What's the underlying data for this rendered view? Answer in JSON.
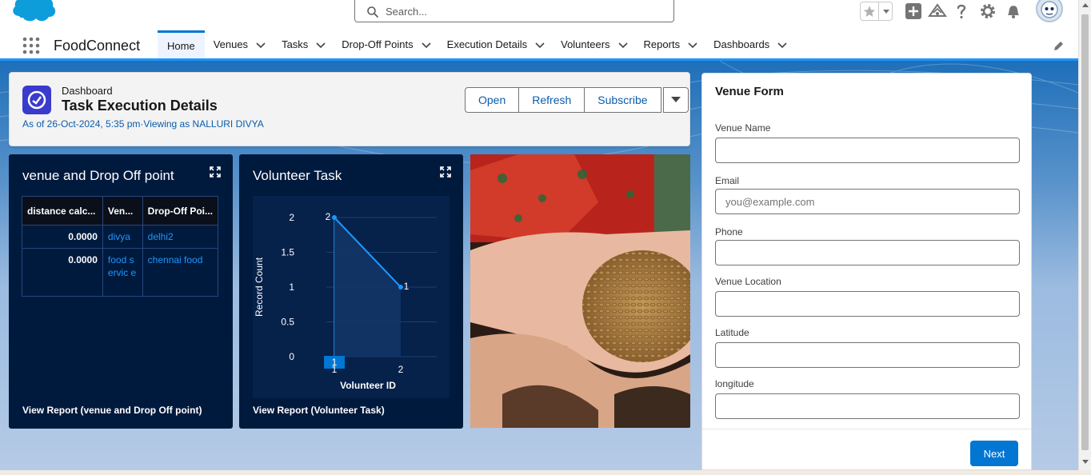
{
  "header": {
    "search_placeholder": "Search..."
  },
  "nav": {
    "app_name": "FoodConnect",
    "items": [
      {
        "label": "Home",
        "active": true,
        "has_menu": false
      },
      {
        "label": "Venues",
        "active": false,
        "has_menu": true
      },
      {
        "label": "Tasks",
        "active": false,
        "has_menu": true
      },
      {
        "label": "Drop-Off Points",
        "active": false,
        "has_menu": true
      },
      {
        "label": "Execution Details",
        "active": false,
        "has_menu": true
      },
      {
        "label": "Volunteers",
        "active": false,
        "has_menu": true
      },
      {
        "label": "Reports",
        "active": false,
        "has_menu": true
      },
      {
        "label": "Dashboards",
        "active": false,
        "has_menu": true
      }
    ]
  },
  "dashboard": {
    "eyebrow": "Dashboard",
    "title": "Task Execution Details",
    "subtitle": "As of 26-Oct-2024, 5:35 pm·Viewing as NALLURI DIVYA",
    "buttons": {
      "open": "Open",
      "refresh": "Refresh",
      "subscribe": "Subscribe"
    }
  },
  "widget_table": {
    "title": "venue and Drop Off point",
    "columns": [
      "distance calc...",
      "Ven...",
      "Drop-Off Poi..."
    ],
    "rows": [
      {
        "distance": "0.0000",
        "venue": "divya",
        "dropoff": "delhi2"
      },
      {
        "distance": "0.0000",
        "venue": "food servic e",
        "dropoff": "chennai food"
      }
    ],
    "footer": "View Report (venue and Drop Off point)"
  },
  "widget_chart": {
    "title": "Volunteer Task",
    "footer": "View Report (Volunteer Task)"
  },
  "chart_data": {
    "type": "area",
    "title": "Volunteer Task",
    "xlabel": "Volunteer ID",
    "ylabel": "Record Count",
    "x": [
      "1",
      "2"
    ],
    "series": [
      {
        "values": [
          2,
          1
        ]
      }
    ],
    "data_labels": [
      "2",
      "1"
    ],
    "ylim": [
      0,
      2
    ],
    "yticks": [
      "0",
      "0.5",
      "1",
      "1.5",
      "2"
    ],
    "highlighted_x_label": "1",
    "grid": true,
    "colors": {
      "line": "#1b96ff",
      "fill": "#123566",
      "background": "#06214a"
    }
  },
  "form": {
    "title": "Venue Form",
    "fields": [
      {
        "label": "Venue Name",
        "value": "",
        "placeholder": ""
      },
      {
        "label": "Email",
        "value": "",
        "placeholder": "you@example.com"
      },
      {
        "label": "Phone",
        "value": "",
        "placeholder": ""
      },
      {
        "label": "Venue Location",
        "value": "",
        "placeholder": ""
      },
      {
        "label": "Latitude",
        "value": "",
        "placeholder": ""
      },
      {
        "label": "longitude",
        "value": "",
        "placeholder": ""
      }
    ],
    "next_label": "Next"
  },
  "colors": {
    "brand_blue": "#0176d3",
    "link_blue": "#0b5cab",
    "widget_bg": "#001a3d",
    "dashboard_icon": "#3a3acd"
  }
}
